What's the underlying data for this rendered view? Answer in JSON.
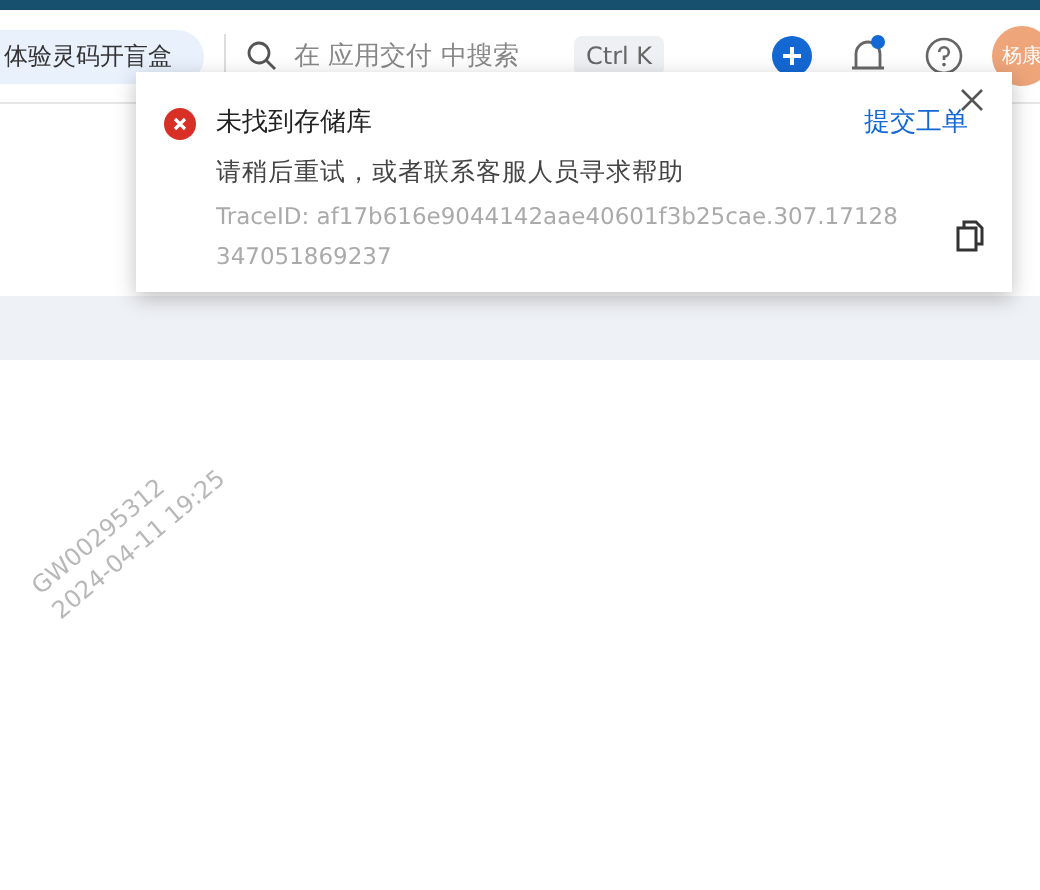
{
  "header": {
    "promo": "体验灵码开盲盒",
    "search": {
      "placeholder": "在 应用交付 中搜索"
    },
    "shortcut": "Ctrl K",
    "notifications_unread": true,
    "avatar": "杨康"
  },
  "toast": {
    "kind": "error",
    "title": "未找到存储库",
    "action": "提交工单",
    "message": "请稍后重试，或者联系客服人员寻求帮助",
    "trace": "TraceID: af17b616e9044142aae40601f3b25cae.307.17128347051869237"
  },
  "watermark": [
    "GW00295312",
    "2024-04-11 19:25"
  ]
}
